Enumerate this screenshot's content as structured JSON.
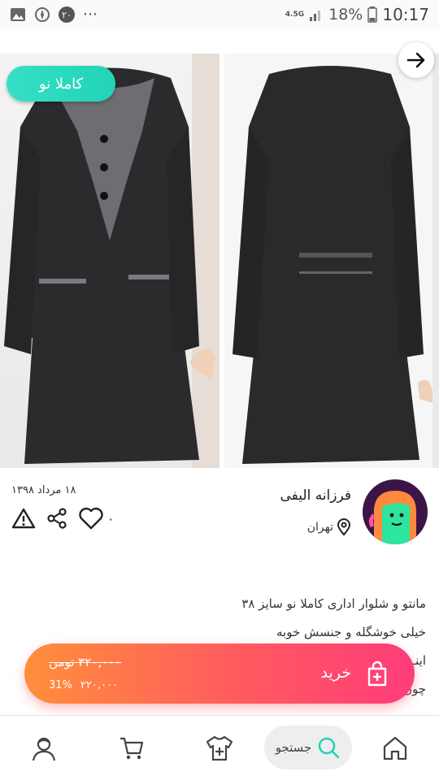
{
  "statusbar": {
    "badge_count": "۲۰",
    "network": "4.5G",
    "battery": "18%",
    "time": "10:17"
  },
  "gallery": {
    "badge": "کاملا نو"
  },
  "product": {
    "date": "۱۸ مرداد ۱۳۹۸",
    "likes": "۰"
  },
  "seller": {
    "name": "فرزانه الیفی",
    "location": "تهران"
  },
  "description": [
    "مانتو و شلوار اداری کاملا نو سایز ۳۸",
    "خیلی خوشگله و جنسش خوبه",
    "اینـ",
    "چون"
  ],
  "buy": {
    "label": "خرید",
    "old_price": "۳۲۰,۰۰۰ تومن",
    "new_price": "۲۲۰,۰۰۰",
    "discount": "31%"
  },
  "nav": {
    "search_label": "جستجو"
  },
  "colors": {
    "accent_teal": "#22d3b6",
    "buy_gradient_start": "#ff8f3b",
    "buy_gradient_end": "#ff3d7a",
    "avatar_bg": "#3b1548"
  }
}
